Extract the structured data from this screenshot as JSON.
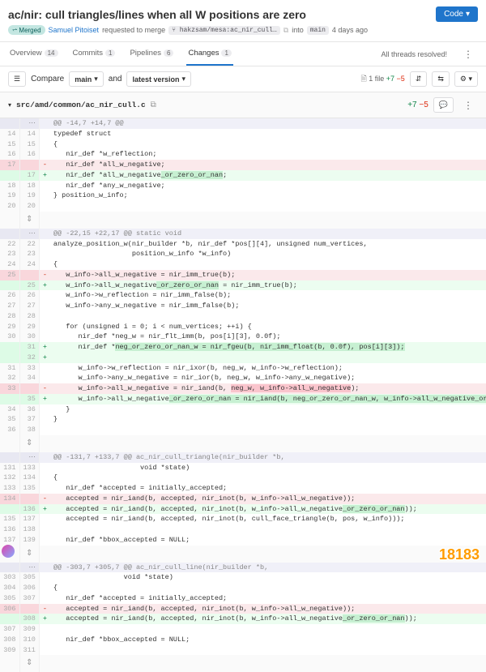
{
  "header": {
    "title": "ac/nir: cull triangles/lines when all W positions are zero",
    "code_btn": "Code",
    "badge": "Merged",
    "author": "Samuel Pitoiset",
    "req_text": "requested to merge",
    "src_branch": "hakzsam/mesa:ac_nir_cull…",
    "into": "into",
    "dst_branch": "main",
    "time": "4 days ago"
  },
  "tabs": {
    "overview": "Overview",
    "overview_n": "14",
    "commits": "Commits",
    "commits_n": "1",
    "pipelines": "Pipelines",
    "pipelines_n": "6",
    "changes": "Changes",
    "changes_n": "1",
    "resolved": "All threads resolved!"
  },
  "toolbar": {
    "compare": "Compare",
    "main": "main",
    "and": "and",
    "latest": "latest version",
    "file_count": "1 file",
    "plus": "+7",
    "minus": "−5"
  },
  "file": {
    "path": "src/amd/common/ac_nir_cull.c",
    "plus": "+7",
    "minus": "−5"
  },
  "hunks": [
    {
      "hdr": "@@ -14,7 +14,7 @@",
      "rows": [
        {
          "t": "ctx",
          "o": "14",
          "n": "14",
          "c": "typedef struct"
        },
        {
          "t": "ctx",
          "o": "15",
          "n": "15",
          "c": "{"
        },
        {
          "t": "ctx",
          "o": "16",
          "n": "16",
          "c": "   nir_def *w_reflection;"
        },
        {
          "t": "rem",
          "o": "17",
          "n": "",
          "c": "   nir_def *all_w_negative;"
        },
        {
          "t": "add",
          "o": "",
          "n": "17",
          "c": "   nir_def *all_w_negative",
          "hl": "_or_zero_or_nan",
          "c2": ";"
        },
        {
          "t": "ctx",
          "o": "18",
          "n": "18",
          "c": "   nir_def *any_w_negative;"
        },
        {
          "t": "ctx",
          "o": "19",
          "n": "19",
          "c": "} position_w_info;"
        },
        {
          "t": "ctx",
          "o": "20",
          "n": "20",
          "c": ""
        }
      ]
    },
    {
      "hdr": "@@ -22,15 +22,17 @@ static void",
      "rows": [
        {
          "t": "ctx",
          "o": "22",
          "n": "22",
          "c": "analyze_position_w(nir_builder *b, nir_def *pos[][4], unsigned num_vertices,"
        },
        {
          "t": "ctx",
          "o": "23",
          "n": "23",
          "c": "                   position_w_info *w_info)"
        },
        {
          "t": "ctx",
          "o": "24",
          "n": "24",
          "c": "{"
        },
        {
          "t": "rem",
          "o": "25",
          "n": "",
          "c": "   w_info->all_w_negative = nir_imm_true(b);"
        },
        {
          "t": "add",
          "o": "",
          "n": "25",
          "c": "   w_info->all_w_negative",
          "hl": "_or_zero_or_nan",
          "c2": " = nir_imm_true(b);"
        },
        {
          "t": "ctx",
          "o": "26",
          "n": "26",
          "c": "   w_info->w_reflection = nir_imm_false(b);"
        },
        {
          "t": "ctx",
          "o": "27",
          "n": "27",
          "c": "   w_info->any_w_negative = nir_imm_false(b);"
        },
        {
          "t": "ctx",
          "o": "28",
          "n": "28",
          "c": ""
        },
        {
          "t": "ctx",
          "o": "29",
          "n": "29",
          "c": "   for (unsigned i = 0; i < num_vertices; ++i) {"
        },
        {
          "t": "ctx",
          "o": "30",
          "n": "30",
          "c": "      nir_def *neg_w = nir_flt_imm(b, pos[i][3], 0.0f);"
        },
        {
          "t": "add",
          "o": "",
          "n": "31",
          "c": "      nir_def *",
          "hl": "neg_or_zero_or_nan_w = nir_fgeu(b, nir_imm_float(b, 0.0f), pos[i][3]);",
          "c2": ""
        },
        {
          "t": "add",
          "o": "",
          "n": "32",
          "c": ""
        },
        {
          "t": "ctx",
          "o": "31",
          "n": "33",
          "c": "      w_info->w_reflection = nir_ixor(b, neg_w, w_info->w_reflection);"
        },
        {
          "t": "ctx",
          "o": "32",
          "n": "34",
          "c": "      w_info->any_w_negative = nir_ior(b, neg_w, w_info->any_w_negative);"
        },
        {
          "t": "rem",
          "o": "33",
          "n": "",
          "c": "      w_info->all_w_negative = nir_iand(b, ",
          "hl": "neg_w, w_info->all_w_negative",
          "c2": ");"
        },
        {
          "t": "add",
          "o": "",
          "n": "35",
          "c": "      w_info->all_w_negative",
          "hl": "_or_zero_or_nan = nir_iand(b, neg_or_zero_or_nan_w, w_info->all_w_negative_or_zero_or_nan",
          "c2": ");"
        },
        {
          "t": "ctx",
          "o": "34",
          "n": "36",
          "c": "   }"
        },
        {
          "t": "ctx",
          "o": "35",
          "n": "37",
          "c": "}"
        },
        {
          "t": "ctx",
          "o": "36",
          "n": "38",
          "c": ""
        }
      ]
    },
    {
      "hdr": "@@ -131,7 +133,7 @@ ac_nir_cull_triangle(nir_builder *b,",
      "rows": [
        {
          "t": "ctx",
          "o": "131",
          "n": "133",
          "c": "                     void *state)"
        },
        {
          "t": "ctx",
          "o": "132",
          "n": "134",
          "c": "{"
        },
        {
          "t": "ctx",
          "o": "133",
          "n": "135",
          "c": "   nir_def *accepted = initially_accepted;"
        },
        {
          "t": "rem",
          "o": "134",
          "n": "",
          "c": "   accepted = nir_iand(b, accepted, nir_inot(b, w_info->all_w_negative));"
        },
        {
          "t": "add",
          "o": "",
          "n": "136",
          "c": "   accepted = nir_iand(b, accepted, nir_inot(b, w_info->all_w_negative",
          "hl": "_or_zero_or_nan",
          "c2": "));"
        },
        {
          "t": "ctx",
          "o": "135",
          "n": "137",
          "c": "   accepted = nir_iand(b, accepted, nir_inot(b, cull_face_triangle(b, pos, w_info)));"
        },
        {
          "t": "ctx",
          "o": "136",
          "n": "138",
          "c": ""
        },
        {
          "t": "ctx",
          "o": "137",
          "n": "139",
          "c": "   nir_def *bbox_accepted = NULL;"
        }
      ]
    },
    {
      "hdr": "@@ -303,7 +305,7 @@ ac_nir_cull_line(nir_builder *b,",
      "rows": [
        {
          "t": "ctx",
          "o": "303",
          "n": "305",
          "c": "                 void *state)"
        },
        {
          "t": "ctx",
          "o": "304",
          "n": "306",
          "c": "{"
        },
        {
          "t": "ctx",
          "o": "305",
          "n": "307",
          "c": "   nir_def *accepted = initially_accepted;"
        },
        {
          "t": "rem",
          "o": "306",
          "n": "",
          "c": "   accepted = nir_iand(b, accepted, nir_inot(b, w_info->all_w_negative));"
        },
        {
          "t": "add",
          "o": "",
          "n": "308",
          "c": "   accepted = nir_iand(b, accepted, nir_inot(b, w_info->all_w_negative",
          "hl": "_or_zero_or_nan",
          "c2": "));"
        },
        {
          "t": "ctx",
          "o": "307",
          "n": "309",
          "c": ""
        },
        {
          "t": "ctx",
          "o": "308",
          "n": "310",
          "c": "   nir_def *bbox_accepted = NULL;"
        },
        {
          "t": "ctx",
          "o": "309",
          "n": "311",
          "c": ""
        }
      ]
    }
  ]
}
